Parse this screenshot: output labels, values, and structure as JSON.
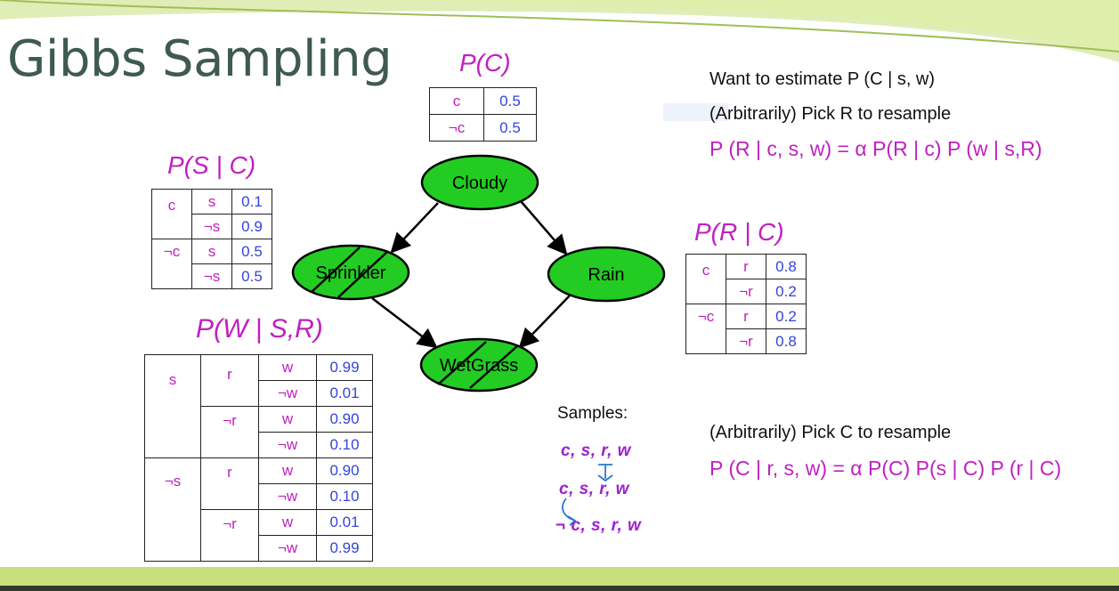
{
  "slide_title": "Gibbs Sampling",
  "colors": {
    "title": "#3f5a4f",
    "magenta": "#c020c0",
    "value_blue": "#3344dd",
    "node_fill": "#22cc22",
    "footer": "#c8de7c"
  },
  "diagram": {
    "nodes": [
      {
        "id": "cloudy",
        "label": "Cloudy",
        "hatched": false
      },
      {
        "id": "sprinkler",
        "label": "Sprinkler",
        "hatched": true
      },
      {
        "id": "rain",
        "label": "Rain",
        "hatched": false
      },
      {
        "id": "wetgrass",
        "label": "WetGrass",
        "hatched": true
      }
    ],
    "edges": [
      {
        "from": "cloudy",
        "to": "sprinkler"
      },
      {
        "from": "cloudy",
        "to": "rain"
      },
      {
        "from": "sprinkler",
        "to": "wetgrass"
      },
      {
        "from": "rain",
        "to": "wetgrass"
      }
    ]
  },
  "cpt_c": {
    "title": "P(C)",
    "rows": [
      [
        "c",
        "0.5"
      ],
      [
        "¬c",
        "0.5"
      ]
    ]
  },
  "cpt_s": {
    "title": "P(S | C)",
    "rows": [
      [
        "c",
        "s",
        "0.1"
      ],
      [
        "",
        "¬s",
        "0.9"
      ],
      [
        "¬c",
        "s",
        "0.5"
      ],
      [
        "",
        "¬s",
        "0.5"
      ]
    ]
  },
  "cpt_r": {
    "title": "P(R | C)",
    "rows": [
      [
        "c",
        "r",
        "0.8"
      ],
      [
        "",
        "¬r",
        "0.2"
      ],
      [
        "¬c",
        "r",
        "0.2"
      ],
      [
        "",
        "¬r",
        "0.8"
      ]
    ]
  },
  "cpt_w": {
    "title": "P(W | S,R)",
    "s_labels": [
      "s",
      "¬s"
    ],
    "r_labels": [
      "r",
      "¬r",
      "r",
      "¬r"
    ],
    "rows": [
      [
        "w",
        "0.99"
      ],
      [
        "¬w",
        "0.01"
      ],
      [
        "w",
        "0.90"
      ],
      [
        "¬w",
        "0.10"
      ],
      [
        "w",
        "0.90"
      ],
      [
        "¬w",
        "0.10"
      ],
      [
        "w",
        "0.01"
      ],
      [
        "¬w",
        "0.99"
      ]
    ]
  },
  "notes": {
    "line1": "Want to estimate P (C | s, w)",
    "line2": "(Arbitrarily) Pick R to resample",
    "eq1": "P (R | c, s, w) =   α  P(R | c) P (w | s,R)",
    "line3": "(Arbitrarily) Pick C to resample",
    "eq2": "P (C | r, s, w) =   α  P(C) P(s | C) P (r | C)"
  },
  "samples": {
    "label": "Samples:",
    "items": [
      "c, s, r, w",
      "c, s, r, w",
      "¬ c, s, r, w"
    ]
  }
}
